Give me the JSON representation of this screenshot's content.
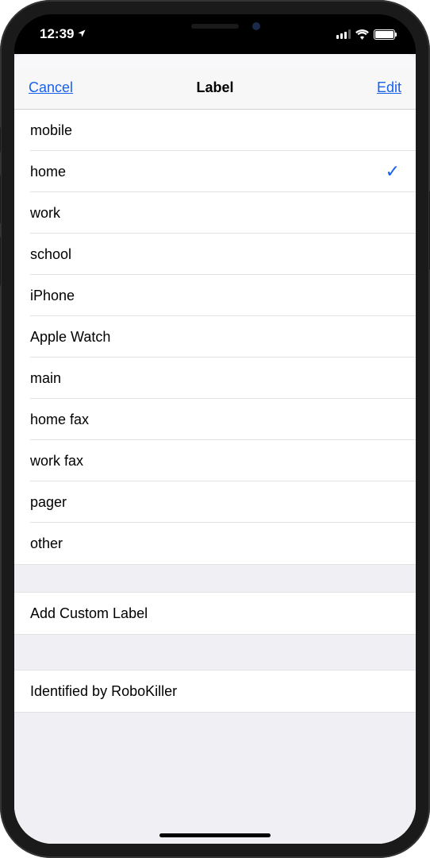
{
  "status": {
    "time": "12:39"
  },
  "nav": {
    "cancel": "Cancel",
    "title": "Label",
    "edit": "Edit"
  },
  "labels": [
    {
      "text": "mobile",
      "selected": false
    },
    {
      "text": "home",
      "selected": true
    },
    {
      "text": "work",
      "selected": false
    },
    {
      "text": "school",
      "selected": false
    },
    {
      "text": "iPhone",
      "selected": false
    },
    {
      "text": "Apple Watch",
      "selected": false
    },
    {
      "text": "main",
      "selected": false
    },
    {
      "text": "home fax",
      "selected": false
    },
    {
      "text": "work fax",
      "selected": false
    },
    {
      "text": "pager",
      "selected": false
    },
    {
      "text": "other",
      "selected": false
    }
  ],
  "custom": {
    "add": "Add Custom Label",
    "existing": "Identified by RoboKiller"
  }
}
